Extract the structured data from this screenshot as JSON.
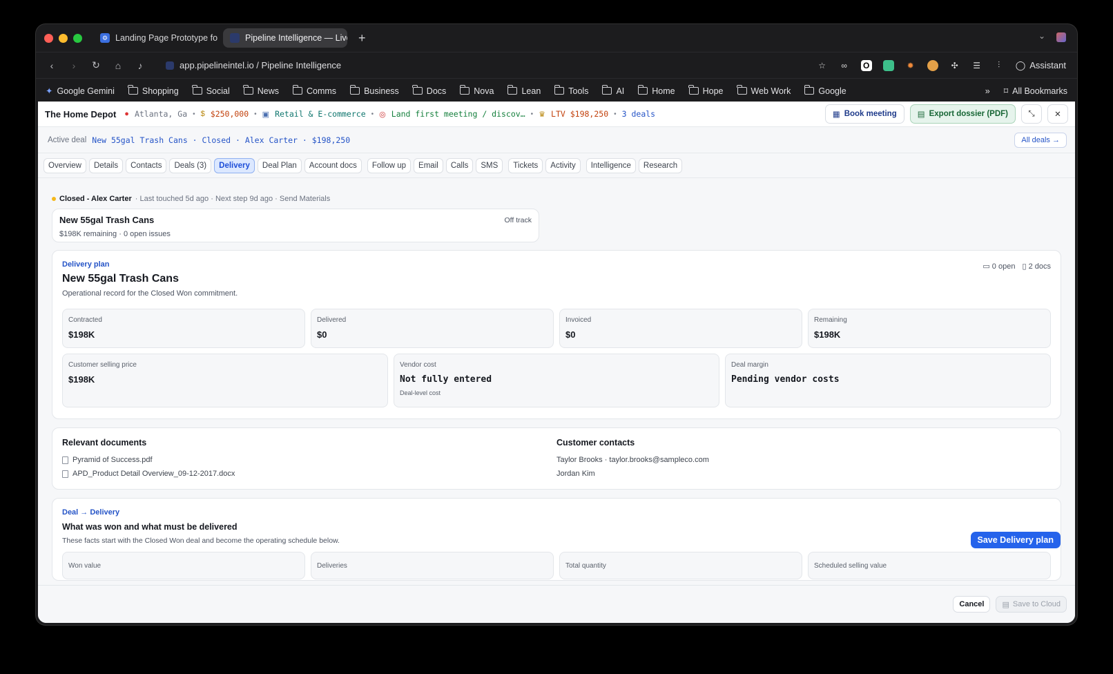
{
  "browser": {
    "tabs": [
      {
        "title": "Landing Page Prototype for f",
        "active": false
      },
      {
        "title": "Pipeline Intelligence — Live A",
        "active": true
      }
    ],
    "url": "app.pipelineintel.io / Pipeline Intelligence",
    "assistant_label": "Assistant",
    "bookmarks": [
      "Google Gemini",
      "Shopping",
      "Social",
      "News",
      "Comms",
      "Business",
      "Docs",
      "Nova",
      "Lean",
      "Tools",
      "AI",
      "Home",
      "Hope",
      "Web Work",
      "Google"
    ],
    "all_bookmarks": "All Bookmarks"
  },
  "header": {
    "company": "The Home Depot",
    "location": "Atlanta, Ga",
    "value": "$250,000",
    "industry": "Retail & E-commerce",
    "goal": "Land first meeting / discov…",
    "ltv": "LTV $198,250",
    "deals": "3 deals",
    "book_meeting": "Book meeting",
    "export": "Export dossier (PDF)"
  },
  "active_deal": {
    "label": "Active deal",
    "value": "New 55gal Trash Cans · Closed · Alex Carter · $198,250",
    "all_deals": "All deals →"
  },
  "tabs": [
    "Overview",
    "Details",
    "Contacts",
    "Deals (3)",
    "Delivery",
    "Deal Plan",
    "Account docs",
    "Follow up",
    "Email",
    "Calls",
    "SMS",
    "Tickets",
    "Activity",
    "Intelligence",
    "Research"
  ],
  "status": {
    "stage": "Closed - Alex Carter",
    "rest": "· Last touched 5d ago · Next step 9d ago · Send Materials"
  },
  "deal_card": {
    "title": "New 55gal Trash Cans",
    "sub": "$198K remaining · 0 open issues",
    "track": "Off track"
  },
  "plan": {
    "eyebrow": "Delivery plan",
    "title": "New 55gal Trash Cans",
    "desc": "Operational record for the Closed Won commitment.",
    "open": "0 open",
    "docs": "2 docs",
    "stats": [
      {
        "k": "Contracted",
        "v": "$198K"
      },
      {
        "k": "Delivered",
        "v": "$0"
      },
      {
        "k": "Invoiced",
        "v": "$0"
      },
      {
        "k": "Remaining",
        "v": "$198K"
      }
    ],
    "pricing": [
      {
        "k": "Customer selling price",
        "v": "$198K",
        "sub": ""
      },
      {
        "k": "Vendor cost",
        "v": "Not fully entered",
        "sub": "Deal-level cost"
      },
      {
        "k": "Deal margin",
        "v": "Pending vendor costs",
        "sub": ""
      }
    ]
  },
  "documents": {
    "title": "Relevant documents",
    "items": [
      "Pyramid of Success.pdf",
      "APD_Product Detail Overview_09-12-2017.docx"
    ]
  },
  "contacts": {
    "title": "Customer contacts",
    "items": [
      "Taylor Brooks · taylor.brooks@sampleco.com",
      "Jordan Kim"
    ]
  },
  "delivery": {
    "eyebrow": "Deal → Delivery",
    "title": "What was won and what must be delivered",
    "desc": "These facts start with the Closed Won deal and become the operating schedule below.",
    "save": "Save Delivery plan",
    "stats": [
      "Won value",
      "Deliveries",
      "Total quantity",
      "Scheduled selling value"
    ]
  },
  "footer": {
    "cancel": "Cancel",
    "save_cloud": "Save to Cloud"
  },
  "colors": {
    "accent": "#2563eb",
    "status_dot": "#f5b81b"
  }
}
